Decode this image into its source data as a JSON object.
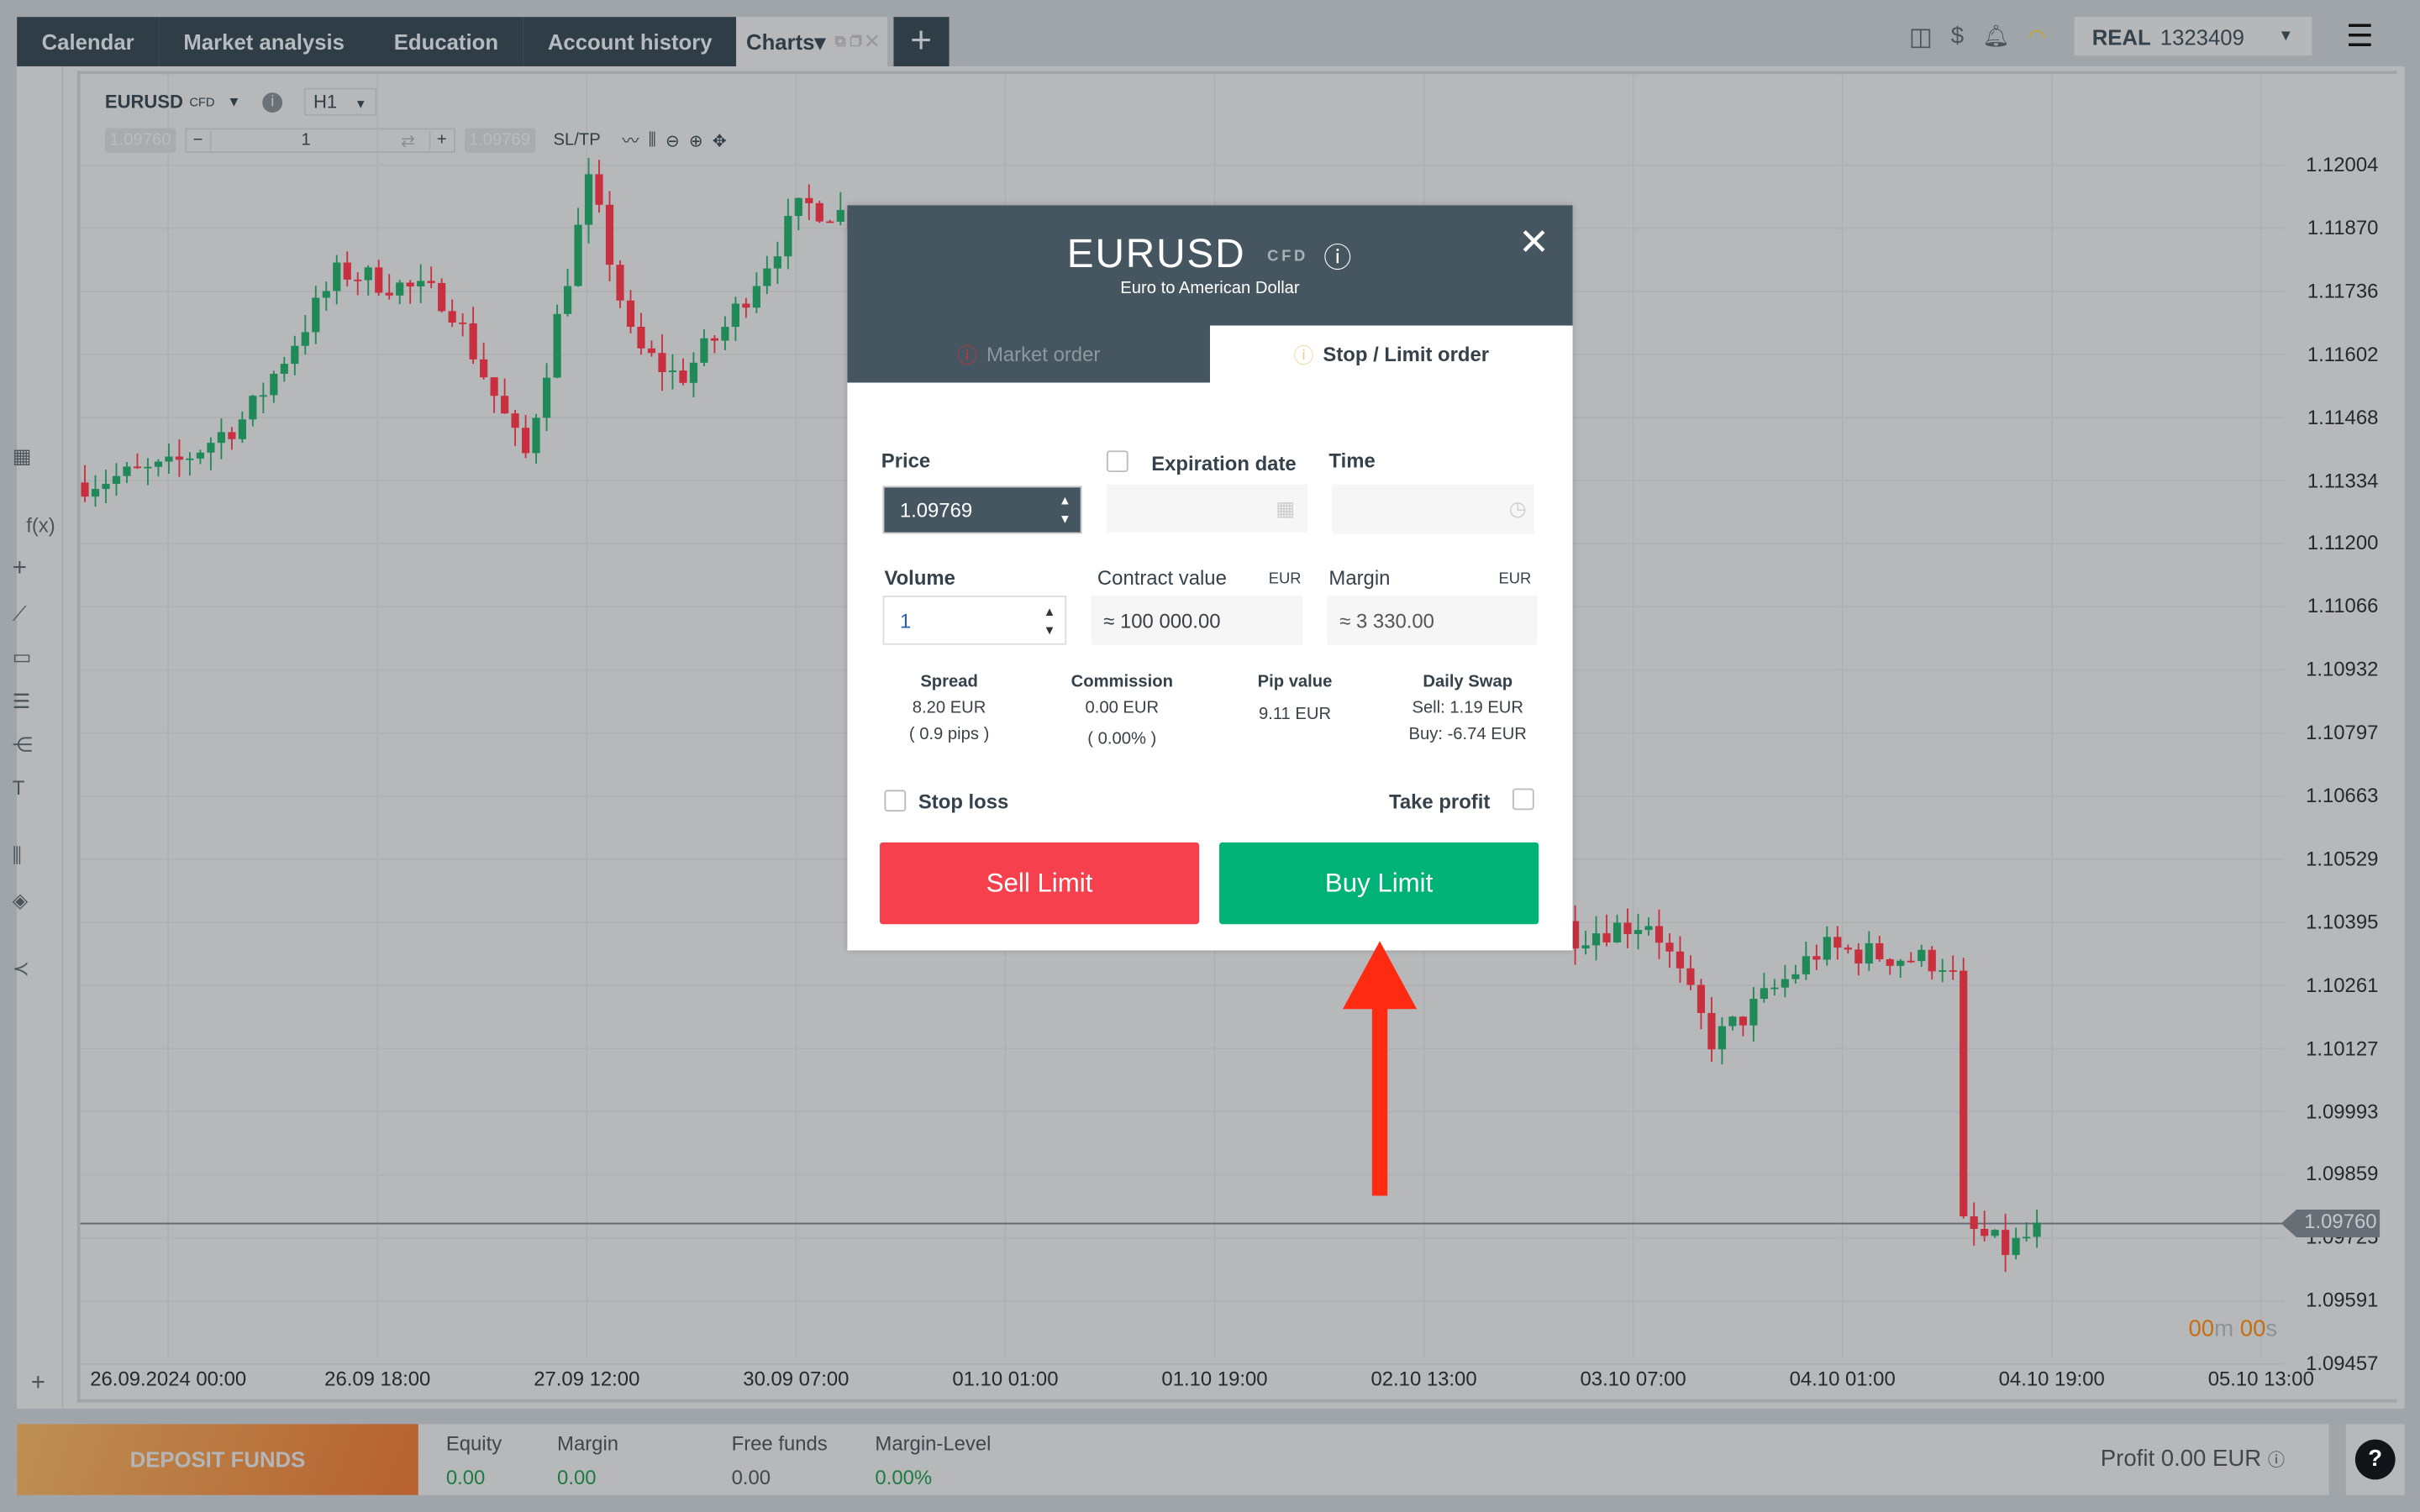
{
  "tabs": [
    {
      "label": "Calendar"
    },
    {
      "label": "Market analysis"
    },
    {
      "label": "Education"
    },
    {
      "label": "Account history"
    },
    {
      "label": "Charts▾"
    }
  ],
  "header": {
    "account_type": "REAL",
    "account_number": "1323409"
  },
  "chart": {
    "symbol": "EURUSD",
    "symbol_tag": "CFD",
    "timeframe": "H1",
    "bid": "1.09760",
    "ask": "1.09769",
    "volume": "1",
    "sltp": "SL/TP",
    "current_price": "1.09760",
    "timer": {
      "m": "00",
      "m_unit": "m",
      "s": "00",
      "s_unit": "s"
    },
    "price_ticks": [
      "1.12004",
      "1.11870",
      "1.11736",
      "1.11602",
      "1.11468",
      "1.11334",
      "1.11200",
      "1.11066",
      "1.10932",
      "1.10797",
      "1.10663",
      "1.10529",
      "1.10395",
      "1.10261",
      "1.10127",
      "1.09993",
      "1.09859",
      "1.09725",
      "1.09591",
      "1.09457"
    ],
    "time_ticks": [
      "26.09.2024 00:00",
      "26.09 18:00",
      "27.09 12:00",
      "30.09 07:00",
      "01.10 01:00",
      "01.10 19:00",
      "02.10 13:00",
      "03.10 07:00",
      "04.10 01:00",
      "04.10 19:00",
      "05.10 13:00"
    ],
    "colors": {
      "up": "#1f8a57",
      "down": "#c8303f"
    }
  },
  "left_tools": [
    "grid-icon",
    "function-icon",
    "crosshair-icon",
    "line-icon",
    "rectangle-icon",
    "fibonacci-icon",
    "pitchfork-icon",
    "text-icon",
    "indicator-icon",
    "layers-icon",
    "share-icon"
  ],
  "bottom": {
    "deposit": "DEPOSIT FUNDS",
    "stats": [
      {
        "label": "Equity",
        "value": "0.00"
      },
      {
        "label": "Margin",
        "value": "0.00"
      },
      {
        "label": "Free funds",
        "value": "0.00"
      },
      {
        "label": "Margin-Level",
        "value": "0.00%"
      }
    ],
    "profit": "Profit 0.00 EUR"
  },
  "modal": {
    "symbol": "EURUSD",
    "tag": "CFD",
    "subtitle": "Euro to American Dollar",
    "tabs": [
      {
        "label": "Market order"
      },
      {
        "label": "Stop / Limit order"
      }
    ],
    "price_label": "Price",
    "price_value": "1.09769",
    "expiration_label": "Expiration date",
    "time_label": "Time",
    "volume_label": "Volume",
    "volume_value": "1",
    "contract_label": "Contract value",
    "contract_cur": "EUR",
    "contract_value": "≈ 100 000.00",
    "margin_label": "Margin",
    "margin_cur": "EUR",
    "margin_value": "≈ 3 330.00",
    "spread_label": "Spread",
    "spread_value": "8.20 EUR",
    "spread_pips": "( 0.9 pips )",
    "commission_label": "Commission",
    "commission_value": "0.00 EUR",
    "commission_pct": "( 0.00% )",
    "pip_label": "Pip value",
    "pip_value": "9.11 EUR",
    "swap_label": "Daily Swap",
    "swap_sell": "Sell: 1.19 EUR",
    "swap_buy": "Buy: -6.74 EUR",
    "stop_loss": "Stop loss",
    "take_profit": "Take profit",
    "sell": "Sell Limit",
    "buy": "Buy Limit",
    "colors": {
      "sell": "#f7404e",
      "buy": "#00b276",
      "header": "#455661"
    }
  }
}
